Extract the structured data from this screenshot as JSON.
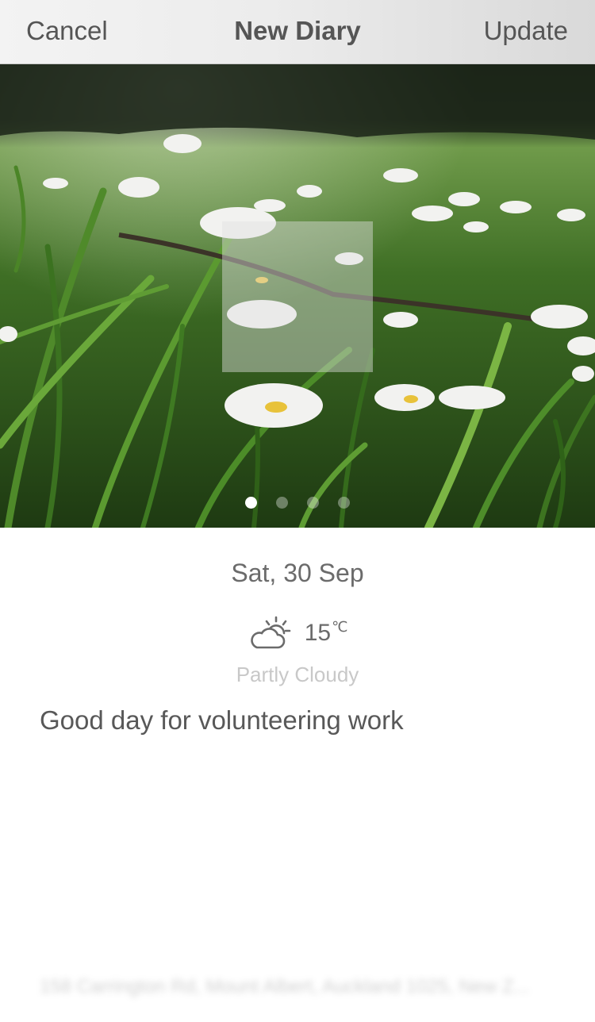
{
  "navbar": {
    "cancel_label": "Cancel",
    "title": "New Diary",
    "update_label": "Update"
  },
  "photo": {
    "subject_icon": "meadow-daisies-photo",
    "page_count": 4,
    "active_page": 1
  },
  "entry": {
    "date": "Sat, 30 Sep",
    "weather": {
      "icon": "partly-cloudy-icon",
      "temperature": "15",
      "unit": "℃",
      "condition": "Partly Cloudy"
    },
    "text": "Good day for volunteering work",
    "location": "158 Carrington Rd, Mount Albert, Auckland 1025, New Z..."
  },
  "colors": {
    "text_primary": "#555555",
    "text_secondary": "#6b6b6b",
    "text_muted": "#c8c8c8",
    "navbar_bg": "#ececec"
  }
}
